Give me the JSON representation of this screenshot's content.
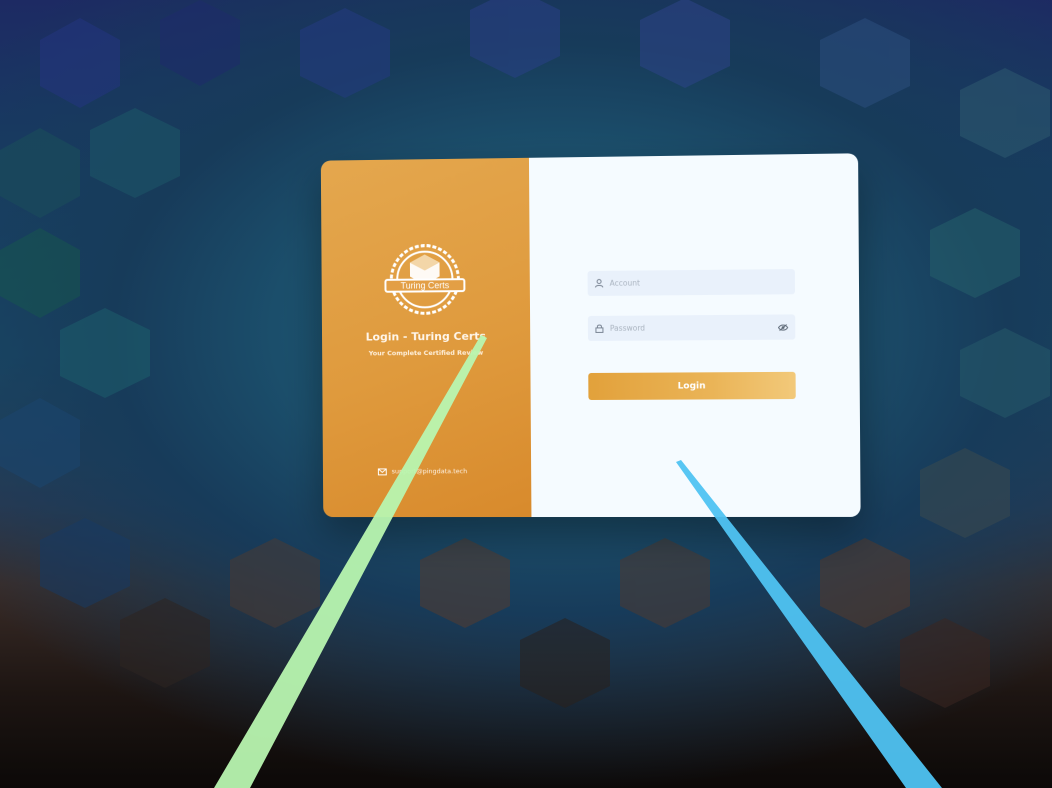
{
  "login_card": {
    "brand": {
      "badge_text": "Turing Certs",
      "title": "Login - Turing Certs",
      "subtitle": "Your Complete Certified Review",
      "contact_email": "support@pingdata.tech"
    },
    "form": {
      "account_placeholder": "Account",
      "account_value": "",
      "password_placeholder": "Password",
      "password_value": "",
      "login_label": "Login"
    }
  },
  "colors": {
    "brand_panel": "#df9a3d",
    "form_panel": "#f5fbff",
    "field_bg": "#e9f1fb",
    "button_start": "#e2a13b",
    "button_end": "#f2c97a",
    "left_ray": "#b8f5b0",
    "right_ray": "#4fc3f2"
  },
  "icons": {
    "account": "user-icon",
    "password": "lock-icon",
    "toggle_password": "eye-icon",
    "contact": "mail-icon",
    "logo": "badge-icon"
  }
}
